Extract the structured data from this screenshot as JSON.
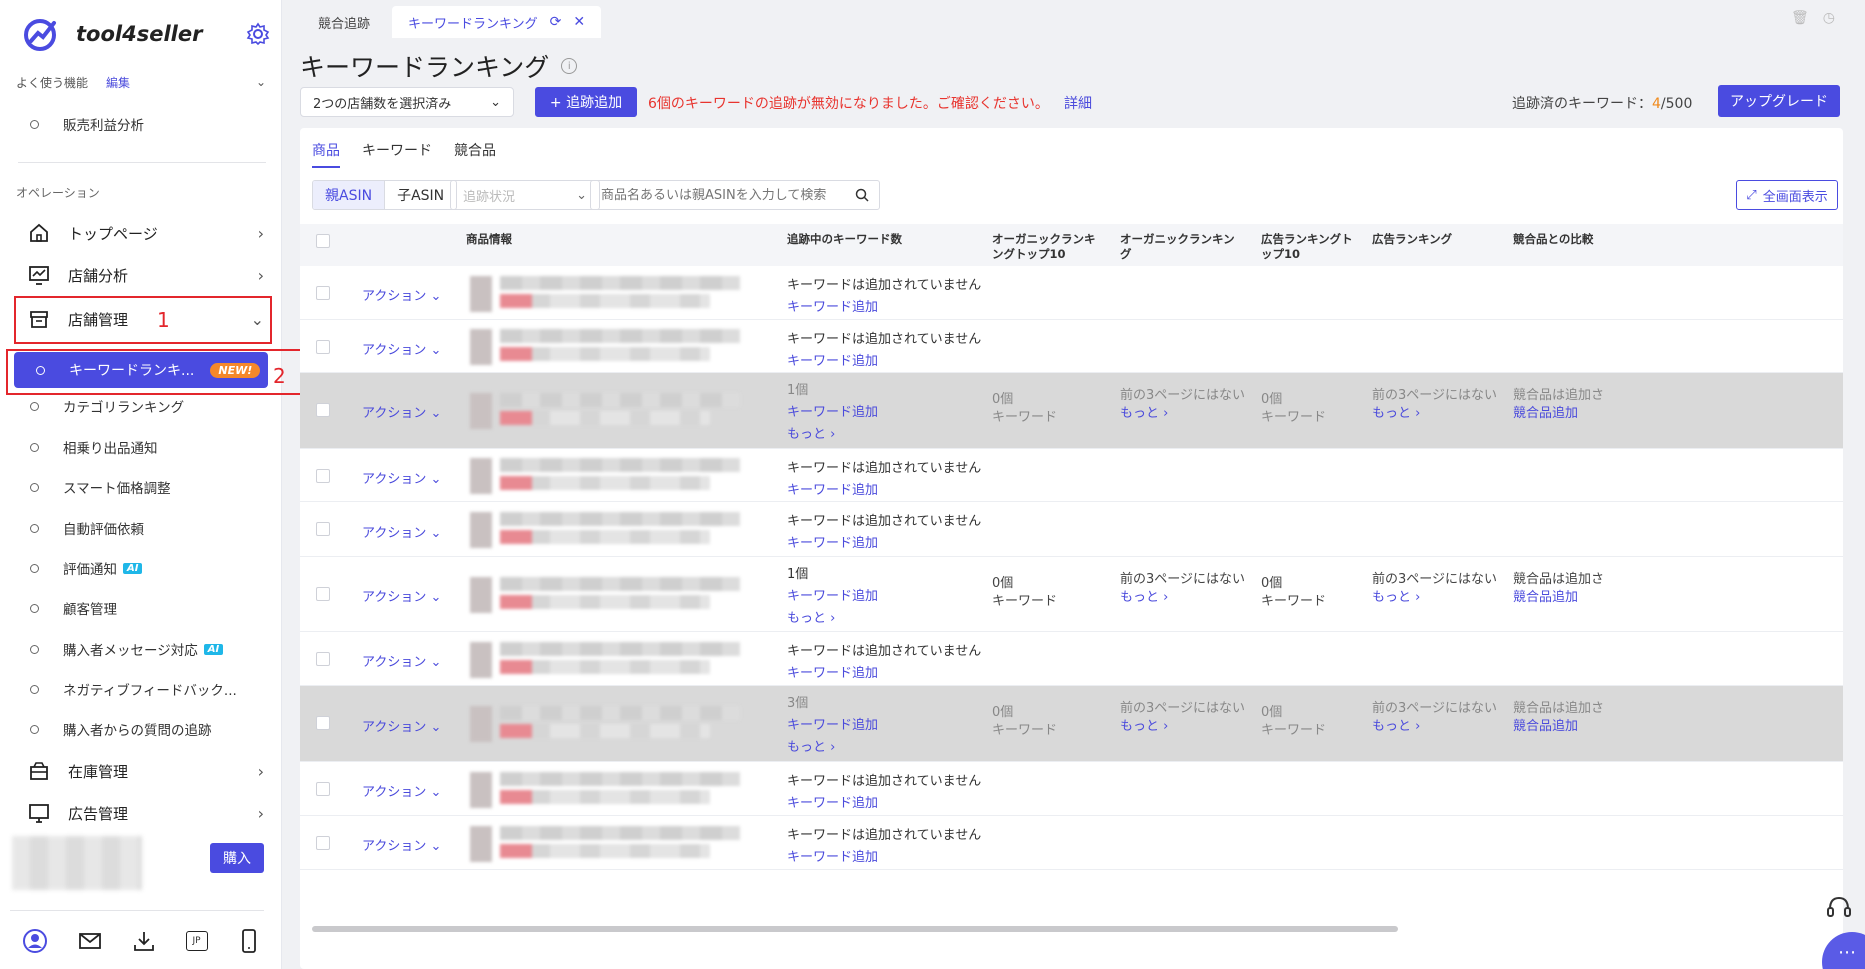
{
  "sidebar": {
    "brand": "tool4seller",
    "favorites_label": "よく使う機能",
    "edit_label": "編集",
    "favorite_items": [
      "販売利益分析"
    ],
    "section_label": "オペレーション",
    "nav": {
      "top_page": "トップページ",
      "store_analysis": "店舗分析",
      "store_management": "店舗管理",
      "inventory": "在庫管理",
      "ads": "広告管理"
    },
    "active_item": "キーワードランキ...",
    "new_badge": "NEW!",
    "sub_items": [
      "カテゴリランキング",
      "相乗り出品通知",
      "スマート価格調整",
      "自動評価依頼",
      "評価通知",
      "顧客管理",
      "購入者メッセージ対応",
      "ネガティブフィードバック...",
      "購入者からの質問の追跡"
    ],
    "ai_badge": "AI",
    "buy_button": "購入",
    "annotation_1": "1",
    "annotation_2": "2",
    "lang_icon_text": "JP"
  },
  "tabs": {
    "tab1": "競合追跡",
    "tab2": "キーワードランキング"
  },
  "header": {
    "title": "キーワードランキング",
    "store_select": "2つの店舗数を選択済み",
    "add_track_button": "+ 追跡追加",
    "warning": "6個のキーワードの追跡が無効になりました。ご確認ください。",
    "detail_link": "詳細",
    "tracked_label": "追跡済のキーワード：",
    "tracked_used": "4",
    "tracked_total": "/500",
    "upgrade_button": "アップグレード"
  },
  "toolbar": {
    "subtabs": [
      "商品",
      "キーワード",
      "競合品"
    ],
    "seg_parent": "親ASIN",
    "seg_child": "子ASIN",
    "status_placeholder": "追跡状況",
    "search_placeholder": "商品名あるいは親ASINを入力して検索",
    "fullscreen_button": "全画面表示"
  },
  "table": {
    "headers": {
      "product": "商品情報",
      "tracking_keywords": "追跡中のキーワード数",
      "organic_top10": "オーガニックランキングトップ10",
      "organic": "オーガニックランキング",
      "ad_top10": "広告ランキングトップ10",
      "ad": "広告ランキング",
      "compare": "競合品との比較"
    },
    "action_label": "アクション",
    "no_keywords": "キーワードは追加されていません",
    "add_keyword": "キーワード追加",
    "more": "もっと",
    "zero_count": "0個",
    "keyword_unit": "キーワード",
    "not_in_3pages": "前の3ページにはない",
    "competitor_not_added": "競合品は追加さ",
    "add_competitor": "競合品追加",
    "counts": {
      "r3": "1個",
      "r6": "1個",
      "r8": "3個"
    }
  }
}
